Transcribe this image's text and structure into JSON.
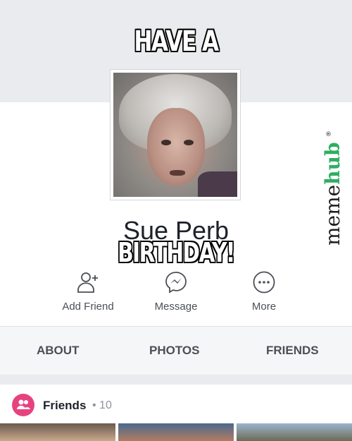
{
  "meme": {
    "top_text": "HAVE A",
    "bottom_text": "BIRTHDAY!"
  },
  "profile": {
    "name": "Sue Perb"
  },
  "watermark": {
    "text": "memehub"
  },
  "actions": [
    {
      "label": "Add Friend",
      "icon": "add-friend-icon"
    },
    {
      "label": "Message",
      "icon": "messenger-icon"
    },
    {
      "label": "More",
      "icon": "more-icon"
    }
  ],
  "tabs": [
    {
      "label": "ABOUT"
    },
    {
      "label": "PHOTOS"
    },
    {
      "label": "FRIENDS"
    }
  ],
  "friends": {
    "title": "Friends",
    "count": "• 10"
  },
  "colors": {
    "accent_badge": "#e6437e",
    "watermark_green": "#2fae61"
  }
}
